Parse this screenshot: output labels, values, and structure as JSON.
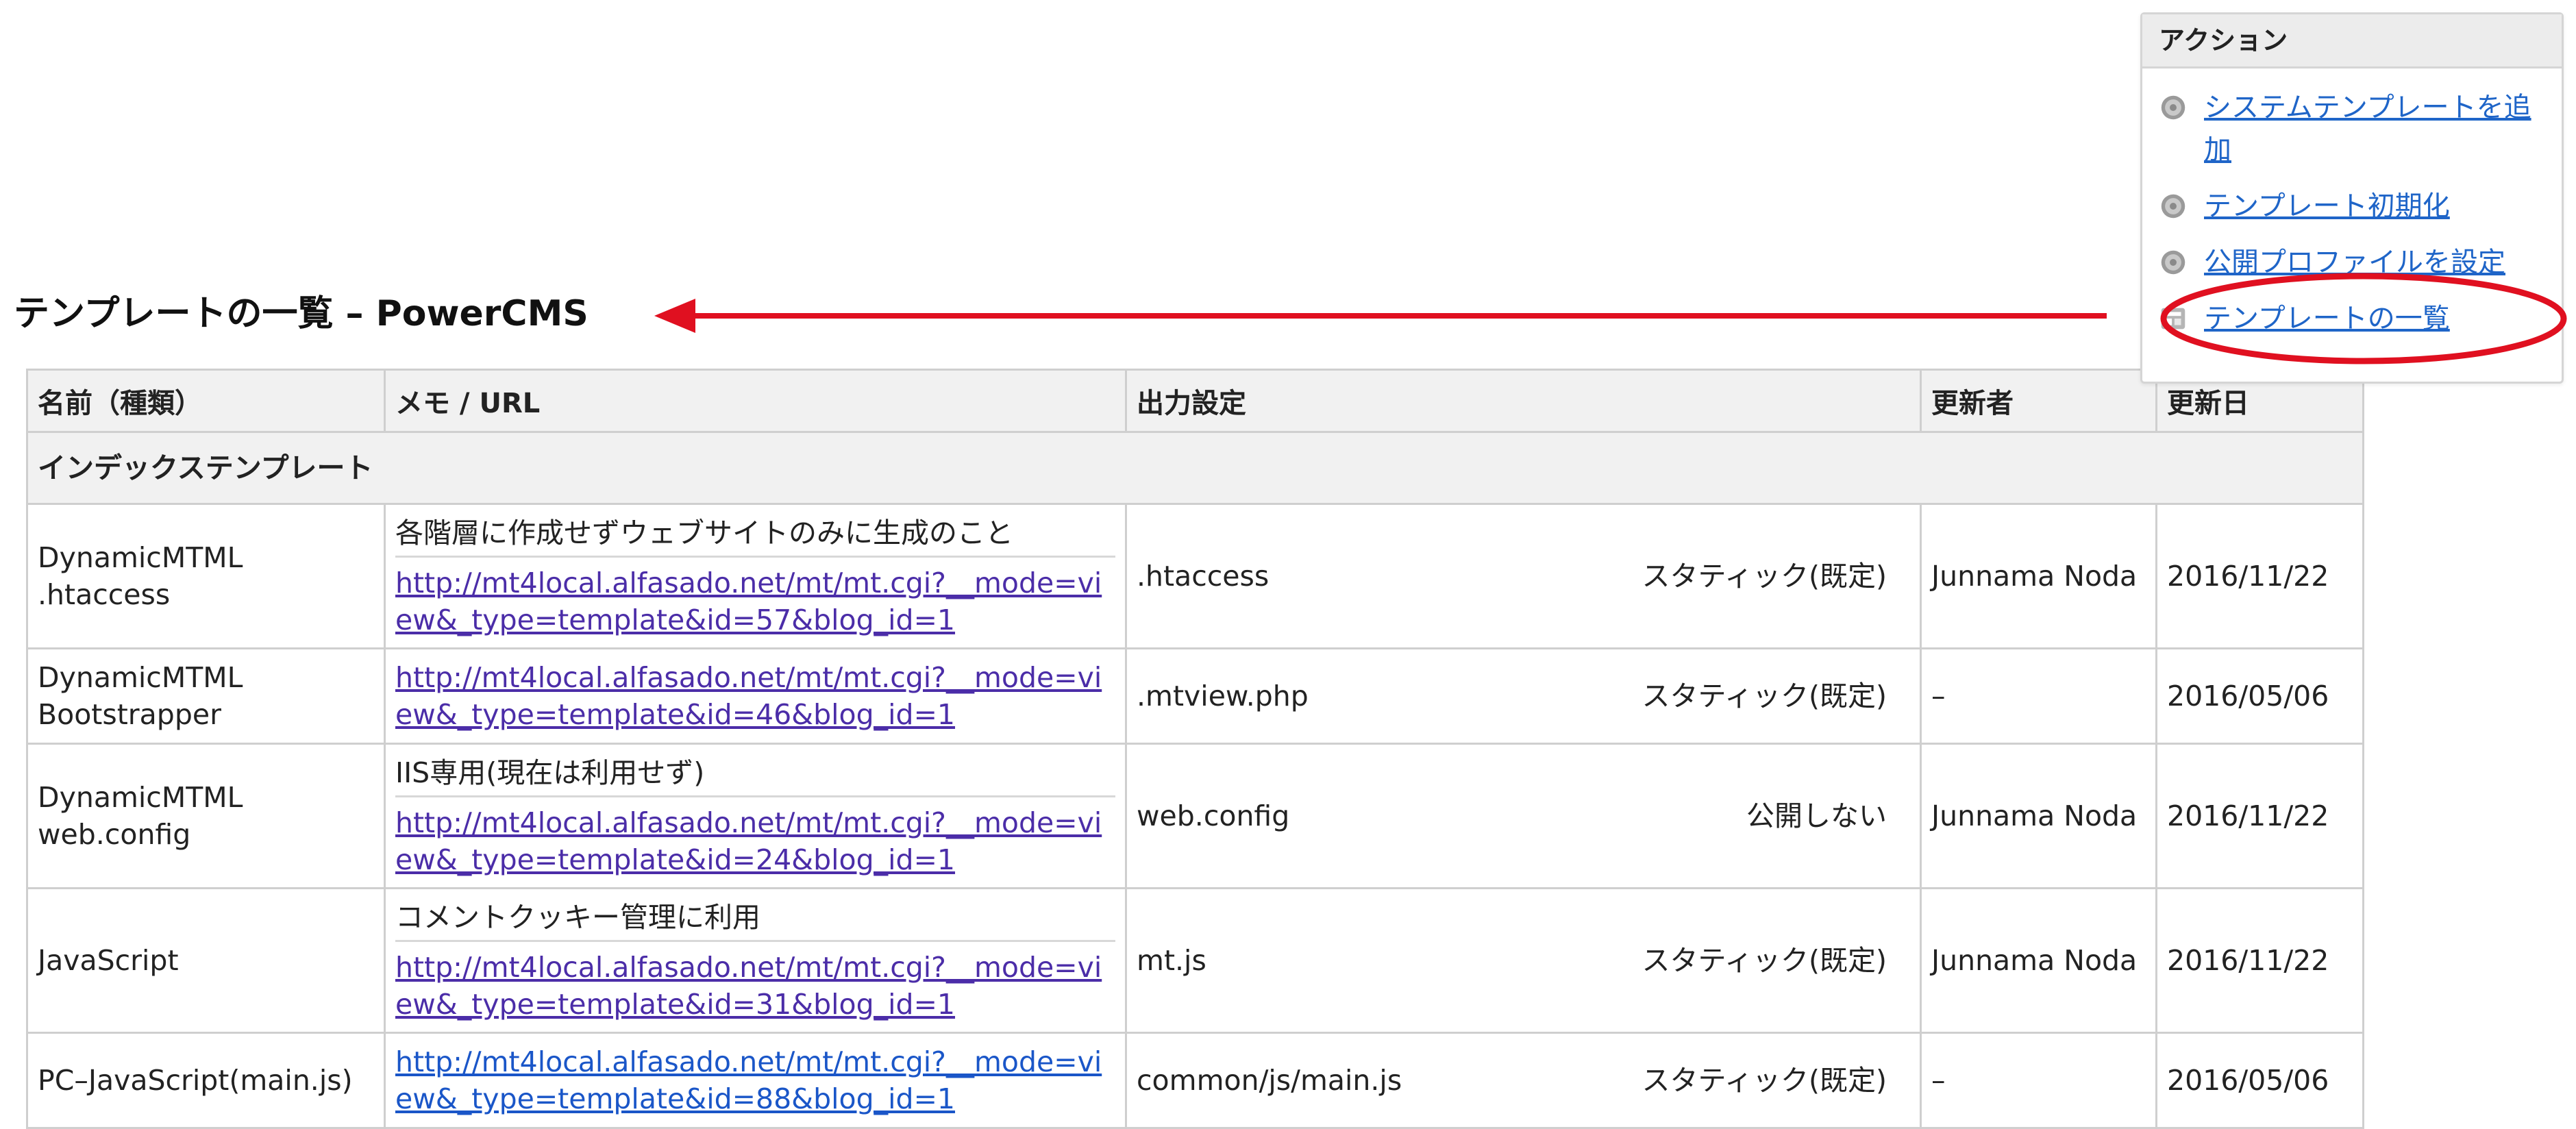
{
  "page": {
    "title": "テンプレートの一覧 – PowerCMS"
  },
  "actions": {
    "title": "アクション",
    "items": [
      {
        "label": "システムテンプレートを追加",
        "icon": "gear-icon"
      },
      {
        "label": "テンプレート初期化",
        "icon": "gear-icon"
      },
      {
        "label": "公開プロファイルを設定",
        "icon": "gear-icon"
      },
      {
        "label": "テンプレートの一覧",
        "icon": "template-list-icon"
      }
    ]
  },
  "table": {
    "columns": [
      "名前（種類）",
      "メモ / URL",
      "出力設定",
      "更新者",
      "更新日"
    ],
    "group": "インデックステンプレート",
    "rows": [
      {
        "name": "DynamicMTML\n.htaccess",
        "memo": "各階層に作成せずウェブサイトのみに生成のこと",
        "url": "http://mt4local.alfasado.net/mt/mt.cgi?__mode=view&_type=template&id=57&blog_id=1",
        "file": ".htaccess",
        "status": "スタティック(既定)",
        "author": "Junnama Noda",
        "date": "2016/11/22"
      },
      {
        "name": "DynamicMTML\nBootstrapper",
        "memo": "",
        "url": "http://mt4local.alfasado.net/mt/mt.cgi?__mode=view&_type=template&id=46&blog_id=1",
        "file": ".mtview.php",
        "status": "スタティック(既定)",
        "author": "–",
        "date": "2016/05/06"
      },
      {
        "name": "DynamicMTML\nweb.config",
        "memo": "IIS専用(現在は利用せず)",
        "url": "http://mt4local.alfasado.net/mt/mt.cgi?__mode=view&_type=template&id=24&blog_id=1",
        "file": "web.config",
        "status": "公開しない",
        "author": "Junnama Noda",
        "date": "2016/11/22"
      },
      {
        "name": "JavaScript",
        "memo": "コメントクッキー管理に利用",
        "url": "http://mt4local.alfasado.net/mt/mt.cgi?__mode=view&_type=template&id=31&blog_id=1",
        "file": "mt.js",
        "status": "スタティック(既定)",
        "author": "Junnama Noda",
        "date": "2016/11/22"
      },
      {
        "name": "PC–JavaScript(main.js)",
        "memo": "",
        "url": "http://mt4local.alfasado.net/mt/mt.cgi?__mode=view&_type=template&id=88&blog_id=1",
        "file": "common/js/main.js",
        "status": "スタティック(既定)",
        "author": "–",
        "date": "2016/05/06"
      }
    ]
  },
  "colors": {
    "link": "#4b2da8",
    "link_blue": "#1a56c8",
    "annotation": "#e01020"
  }
}
